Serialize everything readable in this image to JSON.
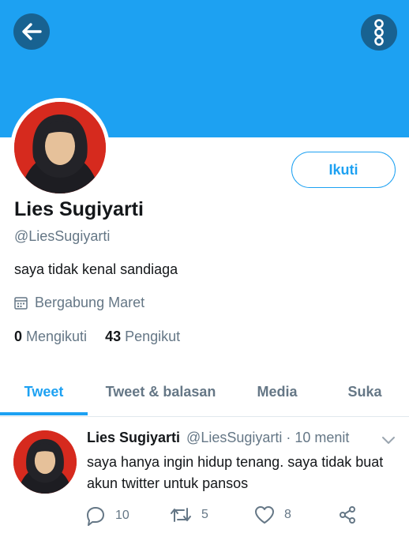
{
  "header": {
    "back_icon": "arrow-left-icon",
    "more_icon": "vertical-dots-icon",
    "banner_color": "#1da1f2"
  },
  "profile": {
    "name": "Lies Sugiyarti",
    "handle": "@LiesSugiyarti",
    "bio": "saya tidak kenal sandiaga",
    "joined": "Bergabung Maret",
    "following_count": "0",
    "following_label": "Mengikuti",
    "followers_count": "43",
    "followers_label": "Pengikut",
    "follow_label": "Ikuti"
  },
  "tabs": [
    {
      "label": "Tweet",
      "active": true
    },
    {
      "label": "Tweet & balasan",
      "active": false
    },
    {
      "label": "Media",
      "active": false
    },
    {
      "label": "Suka",
      "active": false
    }
  ],
  "tweet": {
    "name": "Lies Sugiyarti",
    "meta": "@LiesSugiyarti · 10 menit",
    "text": "saya hanya ingin hidup tenang. saya tidak buat akun twitter untuk pansos",
    "replies": "10",
    "retweets": "5",
    "likes": "8"
  },
  "colors": {
    "accent": "#1da1f2",
    "secondary_text": "#657786",
    "avatar_background": "#d62a1e"
  }
}
